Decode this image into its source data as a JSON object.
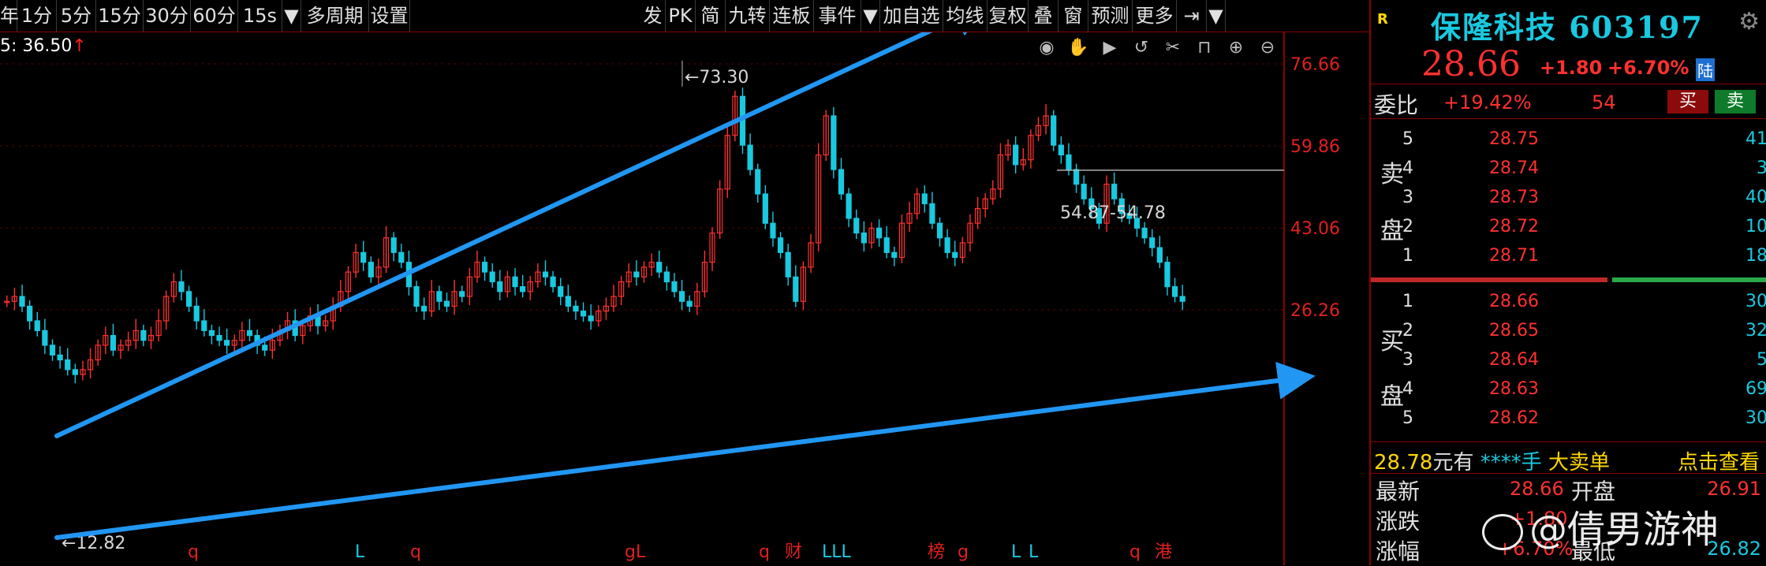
{
  "toolbar": {
    "items": [
      "年",
      "1分",
      "5分",
      "15分",
      "30分",
      "60分",
      "15s",
      "▼",
      "多周期",
      "设置",
      "发",
      "PK",
      "简",
      "九转",
      "连板",
      "事件",
      "▼",
      "加自选",
      "均线",
      "复权",
      "叠",
      "窗",
      "预测",
      "更多",
      "⇥",
      "▼"
    ]
  },
  "ma_readout": {
    "text": "5: 36.50",
    "arrow": "↑"
  },
  "chart_tools": [
    "eye-icon",
    "hand-icon",
    "play-icon",
    "undo-icon",
    "scissors-icon",
    "lock-icon",
    "zoom-in-icon",
    "zoom-out-icon"
  ],
  "chart_data": {
    "type": "candlestick",
    "y_axis_ticks": [
      "76.66",
      "59.86",
      "43.06",
      "26.26"
    ],
    "ylim": [
      16,
      80
    ],
    "annotations": [
      {
        "text": "←73.30",
        "value": 73.3
      },
      {
        "text": "←12.82",
        "value": 12.82
      },
      {
        "text": "54.87-54.78",
        "value": 54.87
      }
    ],
    "close_series": [
      28,
      29,
      27,
      24,
      22,
      19,
      17,
      16,
      14,
      13,
      14,
      16,
      19,
      21,
      18,
      19,
      20,
      22,
      20,
      21,
      24,
      29,
      32,
      30,
      27,
      24,
      22,
      21,
      20,
      19,
      20,
      22,
      21,
      19,
      18,
      20,
      22,
      24,
      21,
      23,
      25,
      23,
      24,
      27,
      30,
      34,
      38,
      36,
      33,
      35,
      41,
      38,
      36,
      31,
      27,
      26,
      30,
      28,
      27,
      30,
      29,
      33,
      36,
      34,
      32,
      30,
      33,
      31,
      30,
      32,
      34,
      33,
      31,
      29,
      27,
      26,
      25,
      24,
      26,
      27,
      29,
      32,
      34,
      33,
      35,
      36,
      34,
      32,
      30,
      28,
      27,
      30,
      36,
      42,
      51,
      62,
      70,
      60,
      55,
      50,
      44,
      41,
      38,
      33,
      28,
      35,
      40,
      58,
      66,
      55,
      50,
      45,
      42,
      40,
      43,
      41,
      38,
      37,
      44,
      46,
      50,
      48,
      44,
      41,
      38,
      37,
      40,
      44,
      47,
      49,
      51,
      58,
      60,
      56,
      57,
      62,
      64,
      66,
      60,
      58,
      55,
      52,
      49,
      47,
      44,
      52,
      49,
      46,
      45,
      43,
      41,
      39,
      36,
      31,
      29,
      28
    ],
    "trend_lines": [
      {
        "from": [
          0,
          14
        ],
        "to": [
          1250,
          78
        ],
        "arrow": true
      },
      {
        "from": [
          0,
          12.82
        ],
        "to": [
          1673,
          41
        ],
        "arrow": true
      }
    ],
    "markers": [
      "q",
      "L",
      "q",
      "gL",
      "q",
      "LLL",
      "榜",
      "g",
      "L",
      "L",
      "财",
      "q",
      "港"
    ]
  },
  "stock": {
    "badge": "R",
    "name": "保隆科技",
    "code": "603197",
    "price": "28.66",
    "change": "+1.80",
    "change_pct": "+6.70%",
    "lu": "陆"
  },
  "weibi": {
    "label": "委比",
    "value": "+19.42%",
    "diff": "54",
    "buy": "买",
    "sell": "卖"
  },
  "asks": {
    "label_top": "卖",
    "label_bottom": "盘",
    "rows": [
      {
        "level": "5",
        "price": "28.75",
        "vol": "41"
      },
      {
        "level": "4",
        "price": "28.74",
        "vol": "3"
      },
      {
        "level": "3",
        "price": "28.73",
        "vol": "40"
      },
      {
        "level": "2",
        "price": "28.72",
        "vol": "10"
      },
      {
        "level": "1",
        "price": "28.71",
        "vol": "18"
      }
    ]
  },
  "bids": {
    "label_top": "买",
    "label_bottom": "盘",
    "rows": [
      {
        "level": "1",
        "price": "28.66",
        "vol": "30"
      },
      {
        "level": "2",
        "price": "28.65",
        "vol": "32"
      },
      {
        "level": "3",
        "price": "28.64",
        "vol": "5"
      },
      {
        "level": "4",
        "price": "28.63",
        "vol": "69"
      },
      {
        "level": "5",
        "price": "28.62",
        "vol": "30"
      }
    ]
  },
  "big_order": {
    "price": "28.78",
    "unit": "元有",
    "stars": "****手",
    "type": "大卖单",
    "action": "点击查看"
  },
  "quote": {
    "last_label": "最新",
    "last_value": "28.66",
    "open_label": "开盘",
    "open_value": "26.91",
    "chg_label": "涨跌",
    "chg_value": "+1.80",
    "pct_label": "涨幅",
    "pct_value": "+6.70%",
    "low_label": "最低",
    "low_value": "26.82"
  },
  "watermark": "@倩男游神",
  "colors": {
    "up": "#ff3030",
    "down": "#19c9e0",
    "trend": "#2196f3",
    "grid": "#7a0000"
  }
}
